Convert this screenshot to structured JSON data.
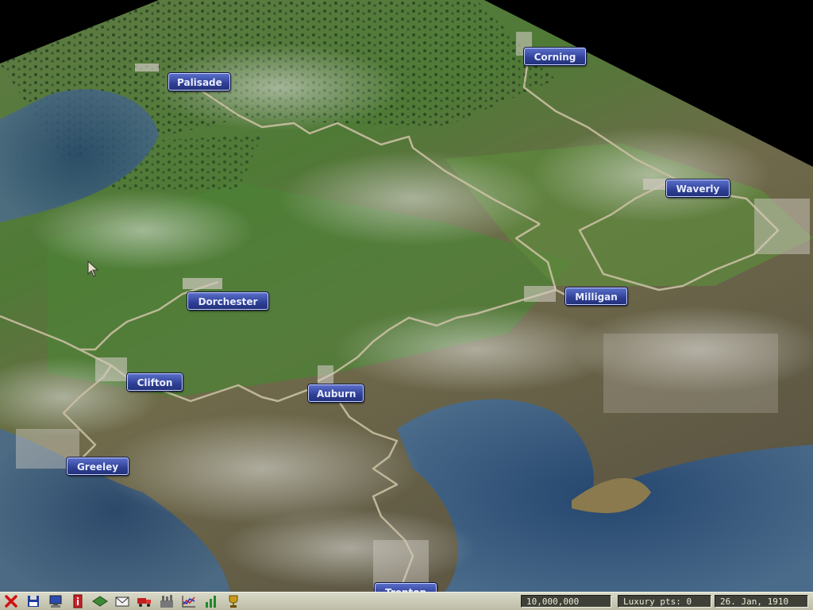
{
  "cities": {
    "corning": "Corning",
    "palisade": "Palisade",
    "waverly": "Waverly",
    "dorchester": "Dorchester",
    "milligan": "Milligan",
    "clifton": "Clifton",
    "auburn": "Auburn",
    "greeley": "Greeley",
    "trenton_partial": "Trenton"
  },
  "toolbar": {
    "icons": [
      "close-icon",
      "save-icon",
      "computer-icon",
      "info-icon",
      "map-icon",
      "mail-icon",
      "truck-icon",
      "factory-icon",
      "chart-line-icon",
      "chart-bar-icon",
      "trophy-icon"
    ]
  },
  "status": {
    "money": "10,000,000",
    "luxury": "Luxury pts: 0",
    "date": "26. Jan, 1910"
  },
  "colors": {
    "label_blue": "#2f3f96",
    "taskbar": "#d0cfbc"
  }
}
